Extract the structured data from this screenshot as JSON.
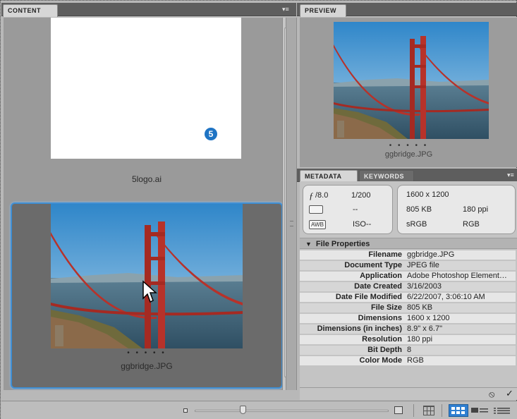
{
  "colors": {
    "accent": "#3f8fd4",
    "view_active": "#2f7fd1",
    "bridge": "#c0392b"
  },
  "content_panel": {
    "tab_label": "CONTENT",
    "menu_icon": "panel-menu-icon",
    "items": [
      {
        "label": "5logo.ai",
        "logo_text": "5"
      },
      {
        "label": "ggbridge.JPG",
        "dots": "• • • • •"
      }
    ]
  },
  "preview_panel": {
    "tab_label": "PREVIEW",
    "dots": "• • • • •",
    "filename": "ggbridge.JPG"
  },
  "metadata_panel": {
    "tabs": [
      "METADATA",
      "KEYWORDS"
    ],
    "camera": {
      "fstop_symbol": "ƒ",
      "aperture": "/8.0",
      "shutter": "1/200",
      "metering_value": "--",
      "wb_icon": "AWB",
      "iso": "ISO--",
      "dimensions": "1600 x 1200",
      "file_size": "805 KB",
      "resolution": "180 ppi",
      "color_profile": "sRGB",
      "color_mode": "RGB"
    },
    "section_title": "File Properties",
    "properties": [
      {
        "key": "Filename",
        "value": "ggbridge.JPG"
      },
      {
        "key": "Document Type",
        "value": "JPEG file"
      },
      {
        "key": "Application",
        "value": "Adobe Photoshop Element…"
      },
      {
        "key": "Date Created",
        "value": "3/16/2003"
      },
      {
        "key": "Date File Modified",
        "value": "6/22/2007, 3:06:10 AM"
      },
      {
        "key": "File Size",
        "value": "805 KB"
      },
      {
        "key": "Dimensions",
        "value": "1600 x 1200"
      },
      {
        "key": "Dimensions (in inches)",
        "value": "8.9\" x 6.7\""
      },
      {
        "key": "Resolution",
        "value": "180 ppi"
      },
      {
        "key": "Bit Depth",
        "value": "8"
      },
      {
        "key": "Color Mode",
        "value": "RGB"
      }
    ],
    "footer": {
      "cancel_symbol": "⦸",
      "apply_symbol": "✓"
    }
  },
  "bottom_bar": {
    "thumbnail_size_fraction": 0.25,
    "view_modes": [
      "grid-view-icon",
      "thumbnail-view-icon",
      "details-view-icon",
      "list-view-icon"
    ]
  }
}
